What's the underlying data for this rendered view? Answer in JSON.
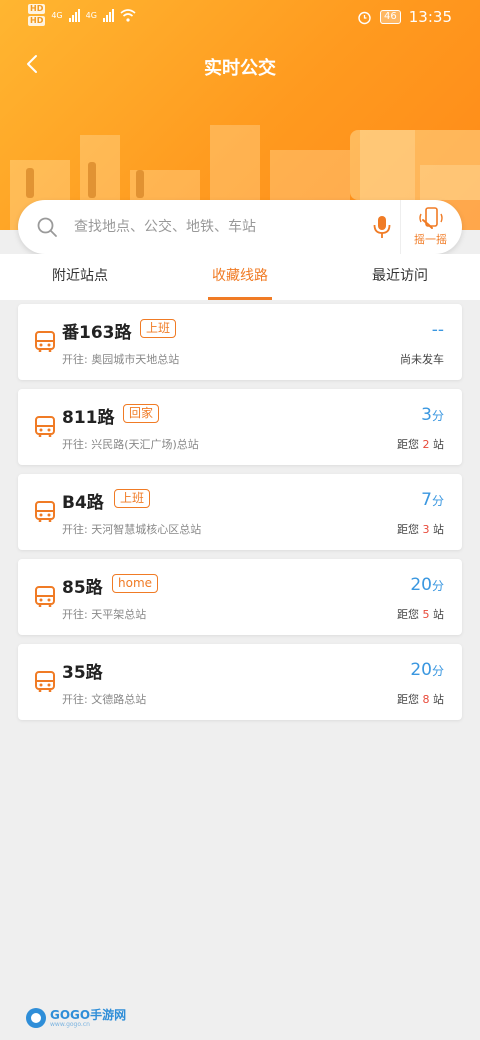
{
  "status_bar": {
    "time": "13:35",
    "battery": "46",
    "network": "4G"
  },
  "header": {
    "title": "实时公交"
  },
  "search": {
    "placeholder": "查找地点、公交、地铁、车站",
    "shake_label": "摇一摇"
  },
  "tabs": [
    {
      "label": "附近站点"
    },
    {
      "label": "收藏线路"
    },
    {
      "label": "最近访问"
    }
  ],
  "active_tab": 1,
  "routes": [
    {
      "name": "番163路",
      "tag": "上班",
      "destination": "开往: 奥园城市天地总站",
      "eta": "--",
      "eta_unit": "",
      "status": "尚未发车"
    },
    {
      "name": "811路",
      "tag": "回家",
      "destination": "开往: 兴民路(天汇广场)总站",
      "eta": "3",
      "eta_unit": "分",
      "dist_prefix": "距您",
      "stops": "2",
      "dist_suffix": "站"
    },
    {
      "name": "B4路",
      "tag": "上班",
      "destination": "开往: 天河智慧城核心区总站",
      "eta": "7",
      "eta_unit": "分",
      "dist_prefix": "距您",
      "stops": "3",
      "dist_suffix": "站"
    },
    {
      "name": "85路",
      "tag": "home",
      "destination": "开往: 天平架总站",
      "eta": "20",
      "eta_unit": "分",
      "dist_prefix": "距您",
      "stops": "5",
      "dist_suffix": "站"
    },
    {
      "name": "35路",
      "tag": "",
      "destination": "开往: 文德路总站",
      "eta": "20",
      "eta_unit": "分",
      "dist_prefix": "距您",
      "stops": "8",
      "dist_suffix": "站"
    }
  ],
  "watermark": {
    "text": "GOGO手游网",
    "sub": "www.gogo.cn"
  },
  "colors": {
    "accent": "#f07b25",
    "eta": "#3a97e0",
    "stops": "#e84a3a",
    "header_from": "#ffb631",
    "header_to": "#ff8a18"
  }
}
